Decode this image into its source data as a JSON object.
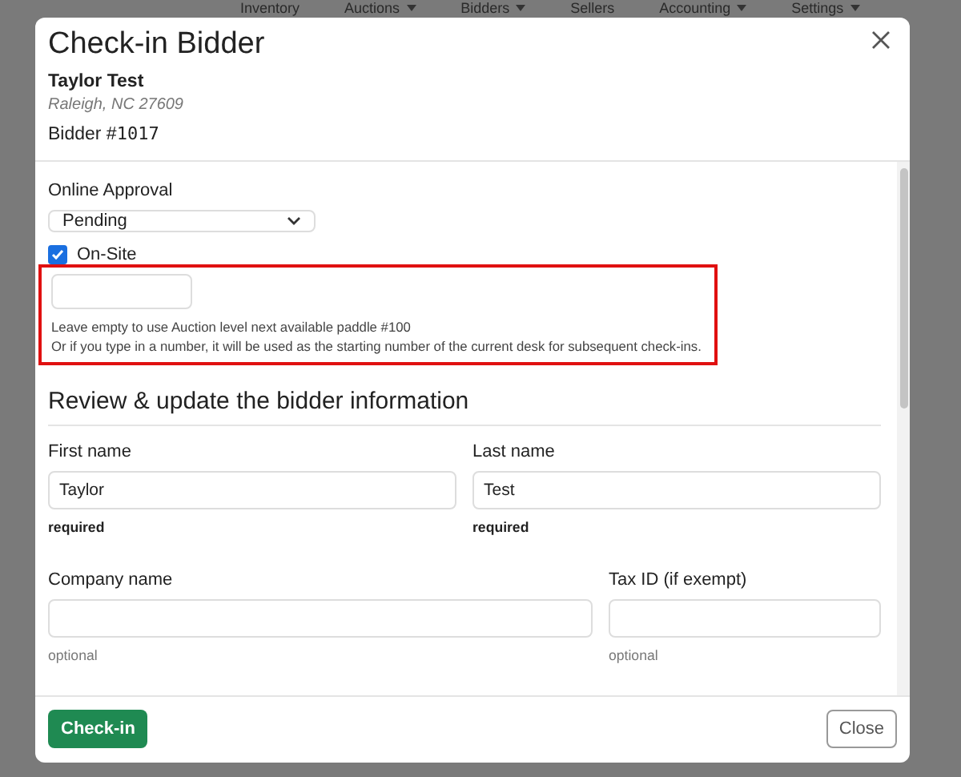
{
  "background_nav": [
    {
      "label": "Inventory",
      "dropdown": false
    },
    {
      "label": "Auctions",
      "dropdown": true
    },
    {
      "label": "Bidders",
      "dropdown": true
    },
    {
      "label": "Sellers",
      "dropdown": false
    },
    {
      "label": "Accounting",
      "dropdown": true
    },
    {
      "label": "Settings",
      "dropdown": true
    }
  ],
  "dialog": {
    "title": "Check-in Bidder",
    "bidder_name": "Taylor Test",
    "location": "Raleigh, NC 27609",
    "bidder_label": "Bidder #",
    "bidder_number": "1017"
  },
  "online_approval": {
    "label": "Online Approval",
    "value": "Pending"
  },
  "on_site": {
    "label": "On-Site",
    "checked": true
  },
  "paddle": {
    "highlighted": true,
    "help": [
      "Leave empty to use Auction level next available paddle #100",
      "Or if you type in a number, it will be used as the starting number of the current desk for subsequent check-ins."
    ]
  },
  "section_title": "Review & update the bidder information",
  "field_rows": [
    {
      "fields": [
        {
          "label": "First name",
          "value": "Taylor",
          "hint": "required",
          "kind": "required"
        },
        {
          "label": "Last name",
          "value": "Test",
          "hint": "required",
          "kind": "required"
        }
      ]
    },
    {
      "fields": [
        {
          "label": "Company name",
          "hint": "optional",
          "kind": "optional",
          "wide": true
        },
        {
          "label": "Tax ID (if exempt)",
          "hint": "optional",
          "kind": "optional",
          "wide": false
        }
      ]
    }
  ],
  "footer": {
    "primary": "Check-in",
    "secondary": "Close"
  }
}
